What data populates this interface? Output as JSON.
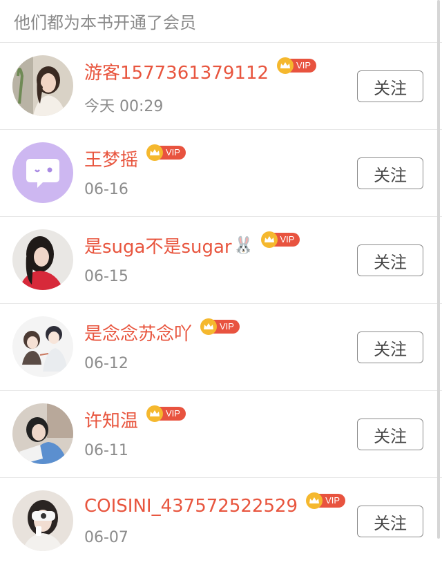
{
  "header": {
    "title": "他们都为本书开通了会员"
  },
  "vip_label": "VIP",
  "follow_label": "关注",
  "members": [
    {
      "name": "游客1577361379112",
      "emoji": "",
      "time": "今天 00:29",
      "avatar": "girl-photo-avatar"
    },
    {
      "name": "王梦摇",
      "emoji": "",
      "time": "06-16",
      "avatar": "default-chat-avatar"
    },
    {
      "name": "是suga不是sugar",
      "emoji": "🐰",
      "time": "06-15",
      "avatar": "girl-photo-avatar"
    },
    {
      "name": "是念念苏念吖",
      "emoji": "",
      "time": "06-12",
      "avatar": "anime-couple-avatar"
    },
    {
      "name": "许知温",
      "emoji": "",
      "time": "06-11",
      "avatar": "girl-photo-avatar"
    },
    {
      "name": "COISINI_437572522529",
      "emoji": "",
      "time": "06-07",
      "avatar": "girl-photo-avatar"
    }
  ],
  "colors": {
    "name": "#e8553e",
    "vip_tag": "#e8533f",
    "crown": "#f5b82e",
    "time": "#8c8c8c"
  }
}
